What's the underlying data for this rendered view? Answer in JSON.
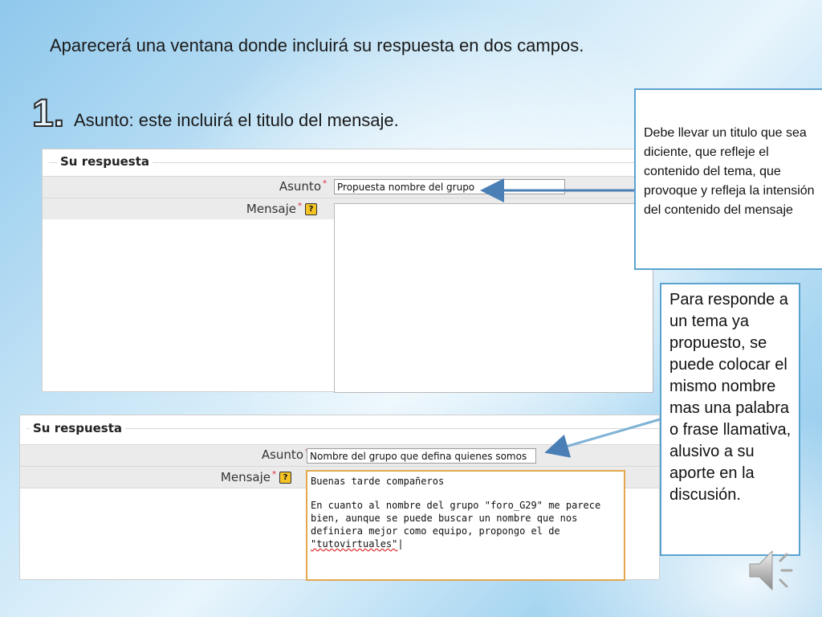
{
  "slide": {
    "intro": "Aparecerá una ventana donde incluirá su respuesta en dos campos.",
    "number": "1.",
    "asunto_line": "Asunto: este incluirá el titulo del mensaje."
  },
  "form1": {
    "legend": "Su respuesta",
    "asunto_label": "Asunto",
    "asunto_value": "Propuesta nombre del grupo",
    "mensaje_label": "Mensaje"
  },
  "form2": {
    "legend": "Su respuesta",
    "asunto_label": "Asunto",
    "asunto_value": "Nombre del grupo que defina quienes somos",
    "mensaje_label": "Mensaje",
    "mensaje_line1": "Buenas tarde compañeros",
    "mensaje_line2": "En cuanto al nombre del grupo \"foro_G29\" me parece",
    "mensaje_line3": "bien, aunque se puede buscar un nombre que nos",
    "mensaje_line4": "definiera mejor como equipo, propongo el de",
    "mensaje_line5": "\"tutovirtuales\""
  },
  "callouts": {
    "top": "Debe llevar un titulo que sea diciente, que refleje el contenido del tema, que provoque y refleja la intensión del contenido del mensaje",
    "bottom": "Para responde a un tema ya propuesto, se puede colocar el mismo nombre mas una palabra o frase llamativa, alusivo a su aporte  en la discusión."
  },
  "icons": {
    "required": "*",
    "help": "?"
  },
  "colors": {
    "callout_border": "#5aa3cf",
    "arrow": "#4a7fb5",
    "textarea_focus": "#e3a84e",
    "required": "#dd2233"
  }
}
